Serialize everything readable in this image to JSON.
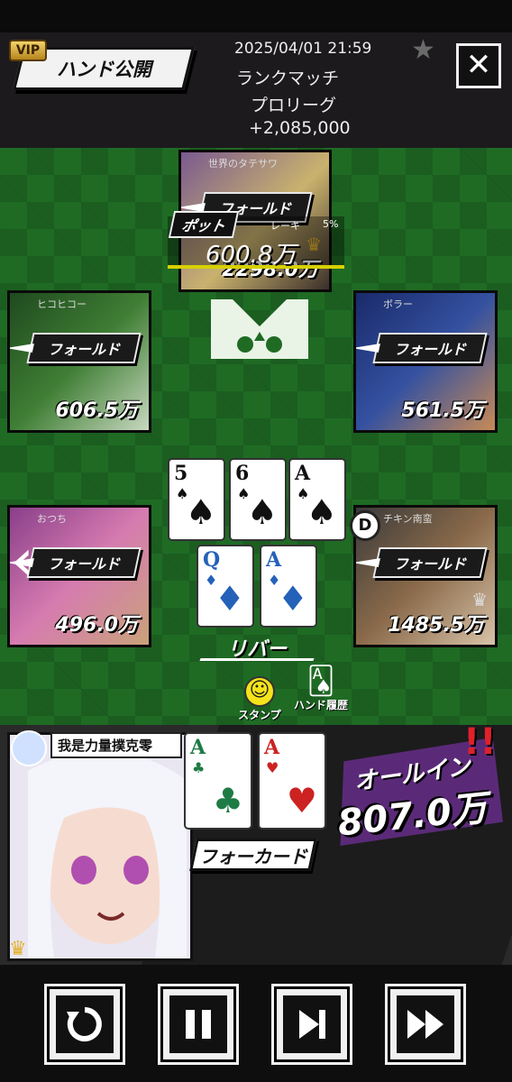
{
  "header": {
    "vip": "VIP",
    "hand_reveal": "ハンド公開",
    "datetime": "2025/04/01 21:59",
    "mode": "ランクマッチ",
    "league": "プロリーグ",
    "amount": "+2,085,000"
  },
  "icons": {
    "star": "star-icon",
    "close": "close-icon"
  },
  "seats": [
    {
      "name": "世界のタテサワ",
      "action": "フォールド",
      "stack": "2298.0万"
    },
    {
      "name": "ヒコヒコー",
      "action": "フォールド",
      "stack": "606.5万"
    },
    {
      "name": "ボラー",
      "action": "フォールド",
      "stack": "561.5万"
    },
    {
      "name": "おつち",
      "action": "フォールド",
      "stack": "496.0万"
    },
    {
      "name": "チキン南蛮",
      "action": "フォールド",
      "stack": "1485.5万"
    }
  ],
  "pot": {
    "label": "ポット",
    "rake_label": "レーキ",
    "rake_value": "5%",
    "amount": "600.8万"
  },
  "board": [
    {
      "rank": "5",
      "suit": "♠"
    },
    {
      "rank": "6",
      "suit": "♠"
    },
    {
      "rank": "A",
      "suit": "♠"
    },
    {
      "rank": "Q",
      "suit": "♦"
    },
    {
      "rank": "A",
      "suit": "♦"
    }
  ],
  "street": "リバー",
  "dealer": "D",
  "actions": {
    "stamp": "スタンプ",
    "history": "ハンド履歴"
  },
  "winner": {
    "name": "我是力量撲克零",
    "hole_cards": [
      {
        "rank": "A",
        "suit": "♣"
      },
      {
        "rank": "A",
        "suit": "♥"
      }
    ],
    "hand": "フォーカード",
    "allin_label": "オールイン",
    "allin_amount": "807.0万",
    "exclaim": "!!"
  },
  "controls": [
    "replay-icon",
    "pause-icon",
    "step-forward-icon",
    "fast-forward-icon"
  ],
  "colors": {
    "felt": "#1f6b24",
    "pot_underline": "#d6d000",
    "allin_bg": "#5a2a78",
    "crown": "#e3b12c"
  }
}
